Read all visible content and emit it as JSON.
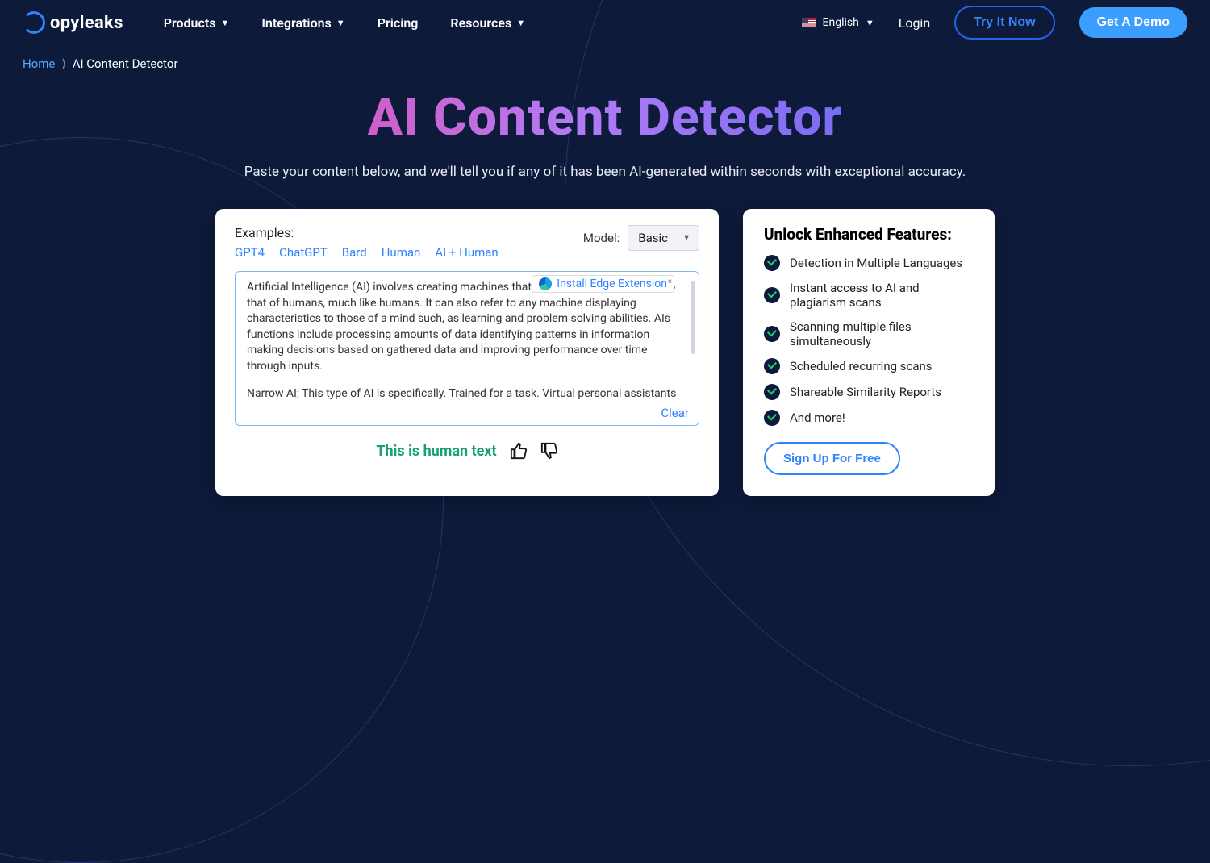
{
  "header": {
    "logo_text": "opyleaks",
    "nav": [
      "Products",
      "Integrations",
      "Pricing",
      "Resources"
    ],
    "language": "English",
    "login": "Login",
    "try_btn": "Try It Now",
    "demo_btn": "Get A Demo"
  },
  "breadcrumb": {
    "home": "Home",
    "separator": "⟩",
    "current": "AI Content Detector"
  },
  "hero": {
    "title": "AI Content Detector",
    "subtitle": "Paste your content below, and we'll tell you if any of it has been AI-generated within seconds with exceptional accuracy."
  },
  "detector": {
    "examples_label": "Examples:",
    "examples": [
      "GPT4",
      "ChatGPT",
      "Bard",
      "Human",
      "AI + Human"
    ],
    "model_label": "Model:",
    "model_value": "Basic",
    "text_p1": "Artificial Intelligence (AI) involves creating machines that mimic intelligence similar to that of humans, much like humans. It can also refer to any machine displaying characteristics to those of a mind such, as learning and problem solving abilities. AIs functions include processing amounts of data identifying patterns in information making decisions based on gathered data and improving performance over time through inputs.",
    "text_p2": "Narrow AI; This type of AI is specifically. Trained for a task. Virtual personal assistants like Apples Siri and Amazons Alexa fall under AI category. These systems are limited to performing the tasks they were programmed for and do not possess intelligence or consciousness.",
    "edge_ext": "Install Edge Extension",
    "clear": "Clear",
    "result": "This is human text"
  },
  "features": {
    "title": "Unlock Enhanced Features:",
    "items": [
      "Detection in Multiple Languages",
      "Instant access to AI and plagiarism scans",
      "Scanning multiple files simultaneously",
      "Scheduled recurring scans",
      "Shareable Similarity Reports",
      "And more!"
    ],
    "signup": "Sign Up For Free"
  }
}
